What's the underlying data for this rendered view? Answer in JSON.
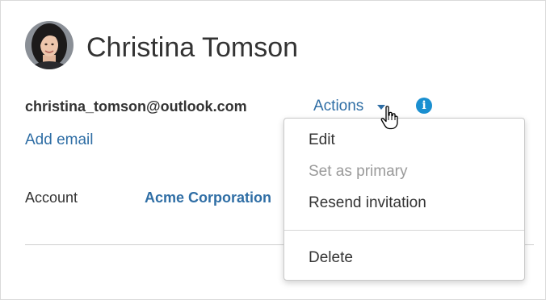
{
  "profile": {
    "name": "Christina Tomson",
    "email": "christina_tomson@outlook.com",
    "actions_label": "Actions",
    "add_email_label": "Add email",
    "account_label": "Account",
    "account_value": "Acme Corporation"
  },
  "menu": {
    "items": [
      {
        "label": "Edit",
        "enabled": true
      },
      {
        "label": "Set as primary",
        "enabled": false
      },
      {
        "label": "Resend invitation",
        "enabled": true
      },
      {
        "label": "Delete",
        "enabled": true
      }
    ]
  },
  "icons": {
    "info": "info-icon",
    "caret": "caret-down-icon",
    "cursor": "hand-pointer-icon"
  },
  "colors": {
    "link": "#2f6ea5",
    "info": "#1a8fd0",
    "text": "#333333",
    "disabled": "#9a9a9a"
  }
}
